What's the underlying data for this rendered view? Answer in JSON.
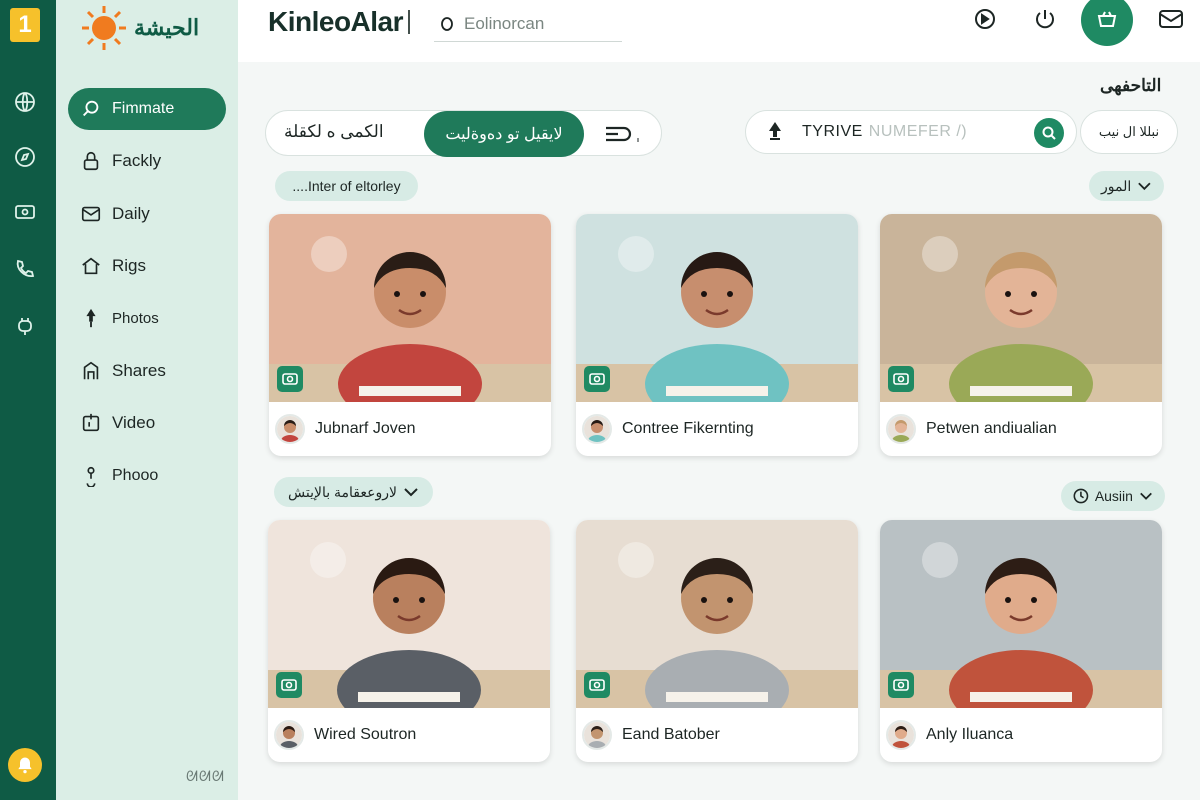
{
  "rail": {
    "badge": "1",
    "icons": [
      "globe-icon",
      "compass-icon",
      "card-icon",
      "phone-icon",
      "plug-icon"
    ],
    "bottom_icon": "bell-icon"
  },
  "sidebar": {
    "brand": "الحيشة",
    "items": [
      {
        "label": "Fimmate",
        "icon": "search-icon",
        "active": true
      },
      {
        "label": "Fackly",
        "icon": "lock-icon"
      },
      {
        "label": "Daily",
        "icon": "mail-icon"
      },
      {
        "label": "Rigs",
        "icon": "home-icon"
      },
      {
        "label": "Photos",
        "icon": "pin-icon"
      },
      {
        "label": "Shares",
        "icon": "frame-icon"
      },
      {
        "label": "Video",
        "icon": "video-icon"
      },
      {
        "label": "Phooo",
        "icon": "figure-icon"
      }
    ],
    "footer": "ᘛᘛᘛ"
  },
  "topbar": {
    "title": "KinleoAlar",
    "search_text": "Eolinorcan",
    "icons": [
      "refresh-icon",
      "power-icon",
      "cart-icon",
      "mail-icon"
    ]
  },
  "main": {
    "section_title": "التاحفهى",
    "toolbar": {
      "left_text": "الكمى ه لكقلة",
      "active_tab": "لايقيل ﺗﻮ ﺩﻩﻭﺓﻟﻴﺖ",
      "right_icon": "menu-icon"
    },
    "search": {
      "value": "TYRIVE",
      "placeholder": "NUMEFER /)"
    },
    "lang_label": "ﻧﺒﻠﻼ ﺍﻝ ﻧﯿﺐ",
    "chips": {
      "row1_left": "....Inter of eltorley",
      "row1_right": "المور",
      "row2_left": "لاروععقامة ﺑﺎﻹﻳﺘﺶ",
      "row2_right": "Ausiin"
    },
    "cards": [
      {
        "name": "Jubnarf Joven",
        "bg": "#e3b49c",
        "shirt": "#c2453e",
        "hair": "#2a1d16",
        "skin": "#c98d6a"
      },
      {
        "name": "Contree Fikernting",
        "bg": "#cfe1e0",
        "shirt": "#6fc2c2",
        "hair": "#261914",
        "skin": "#c78e6e"
      },
      {
        "name": "Petwen andiualian",
        "bg": "#c9b49a",
        "shirt": "#9aa957",
        "hair": "#c49a6c",
        "skin": "#e3b497"
      },
      {
        "name": "Wired Soutron",
        "bg": "#efe4dc",
        "shirt": "#5a5f66",
        "hair": "#2a1a12",
        "skin": "#b9805e"
      },
      {
        "name": "Eand Batober",
        "bg": "#e7ddd2",
        "shirt": "#a9aeb2",
        "hair": "#2b1f18",
        "skin": "#c2946f"
      },
      {
        "name": "Anly Iluanca",
        "bg": "#b9c1c4",
        "shirt": "#c0533c",
        "hair": "#2d1d15",
        "skin": "#e0ab8b"
      }
    ]
  },
  "colors": {
    "primary": "#1f7a5a",
    "rail": "#0f5b45",
    "sidebar": "#dbeee6",
    "accent": "#f6c12b"
  }
}
